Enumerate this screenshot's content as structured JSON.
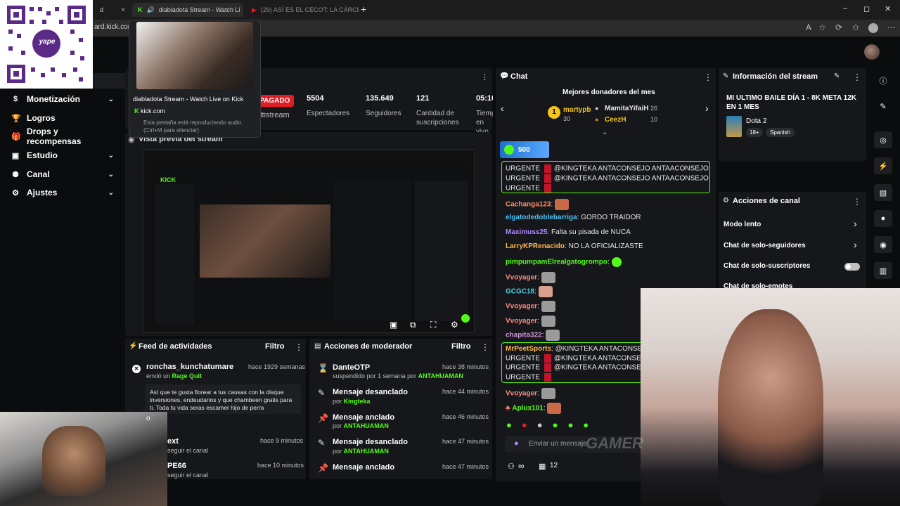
{
  "browser": {
    "tabs": [
      {
        "label": "d",
        "close": "×"
      },
      {
        "label": "diabladota Stream - Watch Li",
        "close": "×"
      },
      {
        "label": "(29) ASÍ ES EL CECOT: LA CÁRCEL",
        "close": "×"
      }
    ],
    "new_tab": "+",
    "url": "ard.kick.com",
    "window_controls": [
      "–",
      "◻",
      "✕"
    ]
  },
  "tooltip": {
    "title": "diabladota Stream - Watch Live on Kick",
    "site": "kick.com",
    "note": "Esta pestaña está reproduciendo audio. (Ctrl+M para silenciar)"
  },
  "qr": {
    "brand": "yape"
  },
  "sidebar": {
    "items": [
      {
        "label": "Monetización",
        "icon": "dollar-icon",
        "chevron": "⌄"
      },
      {
        "label": "Logros",
        "icon": "trophy-icon",
        "chevron": ""
      },
      {
        "label": "Drops y recompensas",
        "icon": "gift-icon",
        "chevron": ""
      },
      {
        "label": "Estudio",
        "icon": "camera-icon",
        "chevron": "⌄"
      },
      {
        "label": "Canal",
        "icon": "user-icon",
        "chevron": "⌄"
      },
      {
        "label": "Ajustes",
        "icon": "gear-icon",
        "chevron": "⌄"
      }
    ]
  },
  "stats": {
    "status": "APAGADO",
    "multistream": "ultistream",
    "viewers": {
      "value": "5504",
      "label": "Espectadores"
    },
    "followers": {
      "value": "135.649",
      "label": "Seguidores"
    },
    "subs": {
      "value": "121",
      "label": "Cantidad de suscripciones"
    },
    "time": {
      "value": "05:10",
      "label": "Tiempo en vivo"
    }
  },
  "preview": {
    "title": "Vista previa del stream",
    "kick": "KICK"
  },
  "activity_feed": {
    "title": "Feed de actividades",
    "filter": "Filtro",
    "items": [
      {
        "name": "ronchas_kunchatumare",
        "time": "hace 1929 semanas",
        "sub_prefix": "envió un",
        "sub_highlight": "Rage Quit",
        "message": "Así que te gusta florear a tus causas con la disque inversiones, endeudarios y que chambeen gratis para ti. Toda tu vida seras escamer hijo de perra"
      },
      {
        "name": "ext",
        "time": "hace 9 minutos",
        "sub": "seguir el canal"
      },
      {
        "name": "PE66",
        "time": "hace 10 minutos",
        "sub": "seguir el canal"
      }
    ],
    "partial": "o"
  },
  "mod_actions": {
    "title": "Acciones de moderador",
    "filter": "Filtro",
    "items": [
      {
        "title": "DanteOTP",
        "time": "hace 38 minutos",
        "sub": "suspendido por 1 semana por",
        "by": "ANTAHUAMAN",
        "icon": "hourglass-icon"
      },
      {
        "title": "Mensaje desanclado",
        "time": "hace 44 minutos",
        "sub": "por",
        "by": "Kingteka",
        "icon": "unpin-icon"
      },
      {
        "title": "Mensaje anclado",
        "time": "hace 46 minutos",
        "sub": "por",
        "by": "ANTAHUAMAN",
        "icon": "pin-icon"
      },
      {
        "title": "Mensaje desanclado",
        "time": "hace 47 minutos",
        "sub": "por",
        "by": "ANTAHUAMAN",
        "icon": "unpin-icon"
      },
      {
        "title": "Mensaje anclado",
        "time": "hace 47 minutos",
        "sub": "por",
        "by": "ANTAHUAMAN",
        "icon": "pin-icon"
      }
    ]
  },
  "chat": {
    "title": "Chat",
    "donors_title": "Mejores donadores del mes",
    "donors": [
      {
        "rank": "1",
        "name": "martypb",
        "amount": "30"
      },
      {
        "name": "MamitaYifaiH",
        "amount": "26"
      },
      {
        "name": "CeezH",
        "amount": "10"
      }
    ],
    "goal": "500",
    "urgent_word": "URGENTE",
    "urgent_msg": "@KINGTEKA ANTACONSEJO ANTAACONSEJO",
    "urgent_msg2": "@KINGTEKA ANTACONSEJO A",
    "messages": [
      {
        "user": "Cachanga123",
        "color": "#ff8a65",
        "text": ""
      },
      {
        "user": "elgatodedoblebarriga",
        "color": "#4fc3f7",
        "text": "GORDO TRAIDOR"
      },
      {
        "user": "Maximuss25",
        "color": "#b388ff",
        "text": "Falta su pisada de NUCA"
      },
      {
        "user": "LarryKPRenacido",
        "color": "#ffb74d",
        "text": "NO LA OFICIALIZASTE"
      },
      {
        "user": "pimpumpamElrealgatogrompo",
        "color": "#53fc18",
        "text": ""
      },
      {
        "user": "Vvoyager",
        "color": "#ff8a80",
        "text": ""
      },
      {
        "user": "GCGC18",
        "color": "#4dd0e1",
        "text": ""
      },
      {
        "user": "Vvoyager",
        "color": "#ff8a80",
        "text": ""
      },
      {
        "user": "Vvoyager",
        "color": "#ff8a80",
        "text": ""
      },
      {
        "user": "chapita322",
        "color": "#ce93d8",
        "text": ""
      }
    ],
    "highlight_user": "MrPeetSports",
    "after": [
      {
        "user": "Vvoyager",
        "color": "#ff8a80"
      },
      {
        "user": "Aplux101",
        "color": "#53fc18"
      }
    ],
    "placeholder": "Enviar un mensaje",
    "count": "12",
    "infinity": "∞"
  },
  "stream_info": {
    "title": "Información del stream",
    "stream_title": "MI ULTIMO BAILE DÍA 1 - 8K META 12K EN 1 MES",
    "game": "Dota 2",
    "age": "18+",
    "language": "Spanish"
  },
  "channel_actions": {
    "title": "Acciones de canal",
    "items": [
      {
        "label": "Modo lento",
        "control": "chevron"
      },
      {
        "label": "Chat de solo-seguidores",
        "control": "chevron"
      },
      {
        "label": "Chat de solo-suscriptores",
        "control": "toggle"
      },
      {
        "label": "Chat de solo-emotes",
        "control": "toggle"
      }
    ]
  },
  "watermark": "GAMER",
  "colors": {
    "kick_green": "#53fc18",
    "live_red": "#e31b23",
    "panel": "#16171a"
  }
}
